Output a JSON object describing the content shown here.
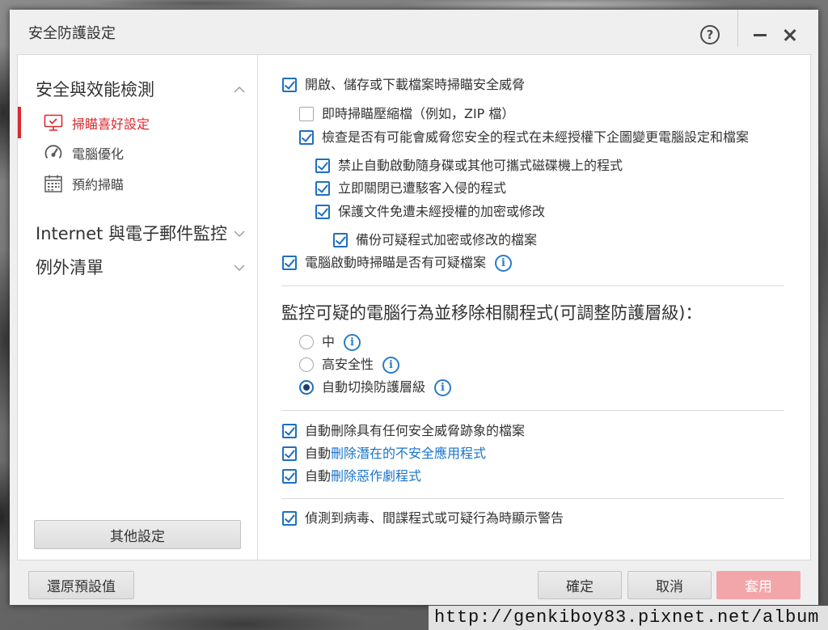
{
  "window": {
    "title": "安全防護設定",
    "icons": {
      "help": "help-icon",
      "minimize": "minimize-icon",
      "close": "close-icon"
    }
  },
  "sidebar": {
    "sections": [
      {
        "label": "安全與效能檢測",
        "expanded": true,
        "chevron": "chevron-up-icon",
        "items": [
          {
            "label": "掃瞄喜好設定",
            "icon": "monitor-icon",
            "selected": true
          },
          {
            "label": "電腦優化",
            "icon": "gauge-icon",
            "selected": false
          },
          {
            "label": "預約掃瞄",
            "icon": "calendar-icon",
            "selected": false
          }
        ]
      },
      {
        "label": "Internet 與電子郵件監控",
        "expanded": false,
        "chevron": "chevron-down-icon"
      },
      {
        "label": "例外清單",
        "expanded": false,
        "chevron": "chevron-down-icon"
      }
    ],
    "other_settings_label": "其他設定"
  },
  "main": {
    "file_scan": {
      "label": "開啟、儲存或下載檔案時掃瞄安全威脅",
      "checked": true,
      "options": [
        {
          "label": "即時掃瞄壓縮檔（例如，ZIP 檔）",
          "checked": false
        },
        {
          "label": "檢查是否有可能會威脅您安全的程式在未經授權下企圖變更電腦設定和檔案",
          "checked": true,
          "options": [
            {
              "label": "禁止自動啟動隨身碟或其他可攜式磁碟機上的程式",
              "checked": true
            },
            {
              "label": "立即關閉已遭駭客入侵的程式",
              "checked": true
            },
            {
              "label": "保護文件免遭未經授權的加密或修改",
              "checked": true,
              "options": [
                {
                  "label": "備份可疑程式加密或修改的檔案",
                  "checked": true
                }
              ]
            }
          ]
        }
      ]
    },
    "startup_scan": {
      "label": "電腦啟動時掃瞄是否有可疑檔案",
      "checked": true,
      "icon": "info-icon"
    },
    "behavior": {
      "heading": "監控可疑的電腦行為並移除相關程式(可調整防護層級)：",
      "levels": [
        {
          "label": "中",
          "selected": false,
          "icon": "info-icon"
        },
        {
          "label": "高安全性",
          "selected": false,
          "icon": "info-icon"
        },
        {
          "label": "自動切換防護層級",
          "selected": true,
          "icon": "info-icon"
        }
      ]
    },
    "auto_delete": [
      {
        "label": "自動刪除具有任何安全威脅跡象的檔案",
        "checked": true
      },
      {
        "prefix": "自動",
        "link": "刪除潛在的不安全應用程式",
        "checked": true
      },
      {
        "prefix": "自動",
        "link": "刪除惡作劇程式",
        "checked": true
      }
    ],
    "show_warning": {
      "label": "偵測到病毒、間諜程式或可疑行為時顯示警告",
      "checked": true
    }
  },
  "footer": {
    "restore_defaults_label": "還原預設值",
    "ok_label": "確定",
    "cancel_label": "取消",
    "apply_label": "套用",
    "apply_enabled": false
  },
  "watermark": "http://genkiboy83.pixnet.net/album",
  "colors": {
    "accent_red": "#d9282e",
    "checkbox_blue": "#1f6fbf",
    "link_blue": "#1a74c9",
    "info_blue": "#2a7cc7",
    "apply_button": "#f3a6aa",
    "dialog_gray": "#efefef"
  }
}
